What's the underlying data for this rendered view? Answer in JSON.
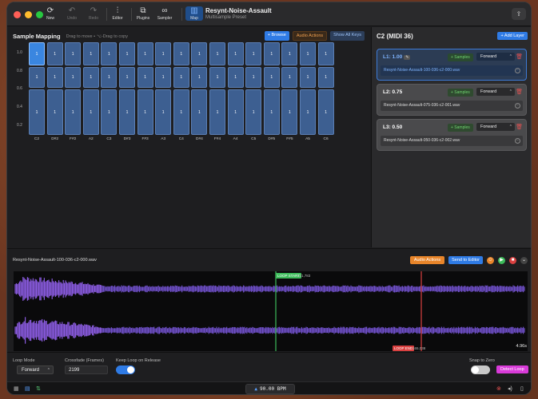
{
  "toolbar": {
    "new_label": "New",
    "undo_label": "Undo",
    "redo_label": "Redo",
    "editor_label": "Editor",
    "plugins_label": "Plugins",
    "sampler_label": "Sampler",
    "map_label": "Map",
    "title": "Resynt-Noise-Assault",
    "subtitle": "Multisample Preset"
  },
  "mapping": {
    "title": "Sample Mapping",
    "hint": "Drag to move • ⌥-Drag to copy",
    "browse_label": "+ Browse",
    "audio_actions_label": "Audio Actions",
    "show_all_keys_label": "Show All Keys",
    "y_ticks": [
      "1.0",
      "0.8",
      "0.6",
      "0.4",
      "0.2"
    ],
    "keys": [
      "C2",
      "D#2",
      "F#2",
      "A2",
      "C3",
      "D#3",
      "F#3",
      "A3",
      "C4",
      "D#4",
      "F#4",
      "A4",
      "C5",
      "D#5",
      "F#5",
      "A5",
      "C6"
    ],
    "cell_label": "1"
  },
  "layers_panel": {
    "title": "C2 (MIDI 36)",
    "add_layer_label": "+ Add Layer",
    "samples_label": "+ Samples",
    "layers": [
      {
        "name": "L1: 1.00",
        "direction": "Forward",
        "file": "Resynt-Noise-Assault-100-036-c2-000.wav"
      },
      {
        "name": "L2: 0.75",
        "direction": "Forward",
        "file": "Resynt-Noise-Assault-075-036-c2-001.wav"
      },
      {
        "name": "L3: 0.50",
        "direction": "Forward",
        "file": "Resynt-Noise-Assault-050-036-c2-002.wav"
      }
    ],
    "edit_badge": "✎"
  },
  "waveform": {
    "file": "Resynt-Noise-Assault-100-036-c2-000.wav",
    "audio_actions_label": "Audio Actions",
    "send_to_editor_label": "Send to Editor",
    "loop_start_label": "LOOP START",
    "loop_start_value": "121,783",
    "loop_end_label": "LOOP END",
    "loop_end_value": "165,038",
    "duration": "4.96s"
  },
  "controls": {
    "loop_mode_label": "Loop Mode",
    "loop_mode_value": "Forward",
    "crossfade_label": "Crossfade (Frames)",
    "crossfade_value": "2199",
    "keep_loop_label": "Keep Loop on Release",
    "snap_label": "Snap to Zero",
    "detect_loop_label": "Detect Loop"
  },
  "status": {
    "bpm": "90.00 BPM"
  },
  "colors": {
    "accent": "#2f7be5",
    "cell": "#3d5f91",
    "loop_start": "#3dbb5a",
    "loop_end": "#d94040",
    "wave": "#7b55d8",
    "detect": "#d93bd9"
  }
}
